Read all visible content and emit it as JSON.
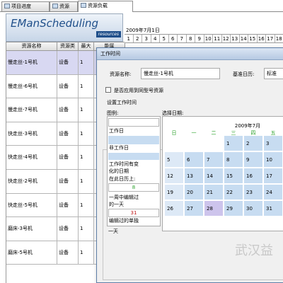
{
  "tabs": [
    {
      "label": "项目进度",
      "active": false
    },
    {
      "label": "资源",
      "active": false
    },
    {
      "label": "资源负载",
      "active": true
    }
  ],
  "brand": {
    "title": "EManScheduling",
    "subtitle": "resources"
  },
  "grid": {
    "columns": [
      "资源名称",
      "资源类",
      "最大",
      "能属"
    ],
    "rows": [
      [
        "慢走丝-1号机",
        "设备",
        "1",
        ""
      ],
      [
        "慢走丝-6号机",
        "设备",
        "1",
        ""
      ],
      [
        "慢走丝-7号机",
        "设备",
        "1",
        ""
      ],
      [
        "快走丝-3号机",
        "设备",
        "1",
        ""
      ],
      [
        "快走丝-4号机",
        "设备",
        "1",
        ""
      ],
      [
        "快走丝-2号机",
        "设备",
        "1",
        ""
      ],
      [
        "快走丝-5号机",
        "设备",
        "1",
        ""
      ],
      [
        "磨床-3号机",
        "设备",
        "1",
        ""
      ],
      [
        "磨床-5号机",
        "设备",
        "1",
        ""
      ]
    ]
  },
  "timeline": {
    "month": "2009年7月1日",
    "days": [
      "1",
      "2",
      "3",
      "4",
      "5",
      "6",
      "7",
      "8",
      "9",
      "10",
      "11",
      "12",
      "13",
      "14",
      "15",
      "16",
      "17",
      "18"
    ]
  },
  "dialog": {
    "title": "工作时间",
    "resource_label": "资源名称:",
    "resource_value": "慢走丝-1号机",
    "basecal_label": "基准日历:",
    "basecal_value": "标准",
    "apply_label": "是否应用到同型号资源",
    "group_label": "设置工作时间",
    "legend_label": "图例:",
    "select_label": "选择日期:",
    "legend": {
      "work": "工作日",
      "nonwork": "非工作日",
      "changed1": "工作时间有变",
      "changed2": "化的日期",
      "oncal": "在此日历上:",
      "oncal_num": "8",
      "weekly1": "一周中编辑过",
      "weekly2": "的一天",
      "weekly_num": "31",
      "single1": "编辑过的单独",
      "single2": "一天"
    },
    "calendar": {
      "month": "2009年7月",
      "weekdays": [
        "日",
        "一",
        "二",
        "三",
        "四",
        "五"
      ],
      "weeks": [
        [
          "",
          "",
          "",
          "1",
          "2",
          "3"
        ],
        [
          "5",
          "6",
          "7",
          "8",
          "9",
          "10"
        ],
        [
          "12",
          "13",
          "14",
          "15",
          "16",
          "17"
        ],
        [
          "19",
          "20",
          "21",
          "22",
          "23",
          "24"
        ],
        [
          "26",
          "27",
          "28",
          "29",
          "30",
          "31"
        ]
      ]
    }
  },
  "watermark": "武汉益"
}
